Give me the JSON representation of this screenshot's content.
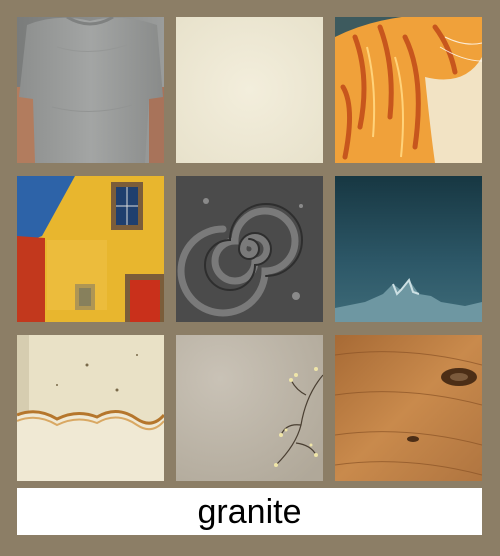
{
  "tiles": [
    {
      "name": "tshirt-tile"
    },
    {
      "name": "cream-paper-tile"
    },
    {
      "name": "orange-fur-tile"
    },
    {
      "name": "painted-house-tile"
    },
    {
      "name": "stone-spiral-tile"
    },
    {
      "name": "teal-mountain-tile"
    },
    {
      "name": "stained-plaster-tile"
    },
    {
      "name": "concrete-branch-tile"
    },
    {
      "name": "wood-knot-tile"
    }
  ],
  "caption": {
    "text": "granite"
  }
}
